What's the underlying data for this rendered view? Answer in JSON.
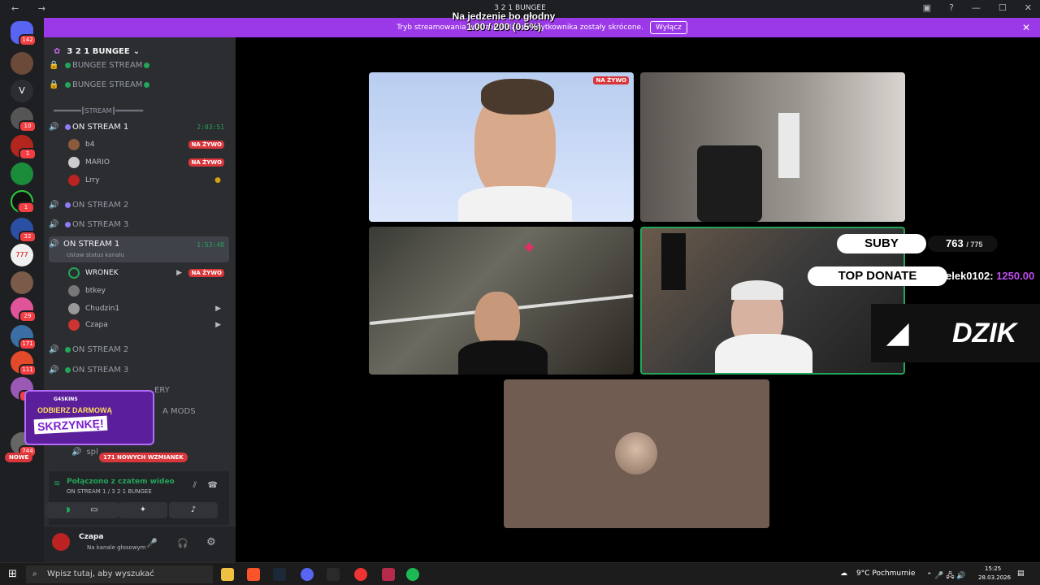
{
  "window": {
    "title": "3 2 1 BUNGEE",
    "nav": "← →",
    "controls": [
      "▣",
      "?",
      "—",
      "☐",
      "✕"
    ]
  },
  "stream_overlay": {
    "line1": "Na jedzenie bo głodny",
    "line2": "1.00 / 200 (0.5%)"
  },
  "banner": {
    "text": "Tryb streamowania włączony. Nazwy użytkownika zostały skrócone.",
    "button": "Wyłącz",
    "close": "✕"
  },
  "guild_badges": [
    "142",
    "10",
    "1",
    "1",
    "32",
    "29",
    "171",
    "111",
    "14",
    "744"
  ],
  "guild_letters": {
    "v": "V",
    "n777": "777"
  },
  "server": {
    "name": "3 2 1 BUNGEE",
    "chev": "⌄",
    "invite": "+"
  },
  "channels": {
    "bungee1": "BUNGEE STREAM",
    "bungee2": "BUNGEE STREAM",
    "category": "═══════║STREAM║═══════",
    "on_stream_1a": "ON STREAM 1",
    "on_stream_1a_timer": "2:03:51",
    "users_1a": [
      {
        "name": "b4",
        "badge": "NA ŻYWO"
      },
      {
        "name": "MARIO",
        "badge": "NA ŻYWO"
      },
      {
        "name": "Lrry",
        "badge": ""
      }
    ],
    "on_stream_2a": "ON STREAM 2",
    "on_stream_3a": "ON STREAM 3",
    "on_stream_1b": "ON STREAM 1",
    "on_stream_1b_timer": "1:53:48",
    "status_hint": "Ustaw status kanału",
    "users_1b": [
      {
        "name": "WRONEK",
        "badge": "NA ŻYWO"
      },
      {
        "name": "btkey",
        "badge": ""
      },
      {
        "name": "Chudzin1",
        "badge": ""
      },
      {
        "name": "Czapa",
        "badge": ""
      }
    ],
    "on_stream_2b": "ON STREAM 2",
    "on_stream_3b": "ON STREAM 3",
    "partial1": "ERY",
    "partial2": "A MODS",
    "partial3": "spl"
  },
  "promo": {
    "brand": "G4SKINS",
    "line1": "ODBIERZ DARMOWĄ",
    "line2": "SKRZYNKĘ!"
  },
  "pills": {
    "new": "NOWE",
    "mentions": "171 NOWYCH WZMIANEK"
  },
  "voice": {
    "status": "Połączono z czatem wideo",
    "sub": "ON STREAM 1 / 3 2 1 BUNGEE"
  },
  "user": {
    "name": "Czapa",
    "status": "Na kanale głosowym"
  },
  "tiles": {
    "live": "NA ŻYWO"
  },
  "right_overlay": {
    "suby": "SUBY",
    "suby_count": "763",
    "suby_goal": "/ 775",
    "top_donate": "TOP DONATE",
    "donor": "elek0102:",
    "donate_amount": "1250.00",
    "brand": "DZIK"
  },
  "taskbar": {
    "search": "Wpisz tutaj, aby wyszukać",
    "weather": "9°C  Pochmurnie",
    "time": "15:25",
    "date": "28.03.2026"
  }
}
